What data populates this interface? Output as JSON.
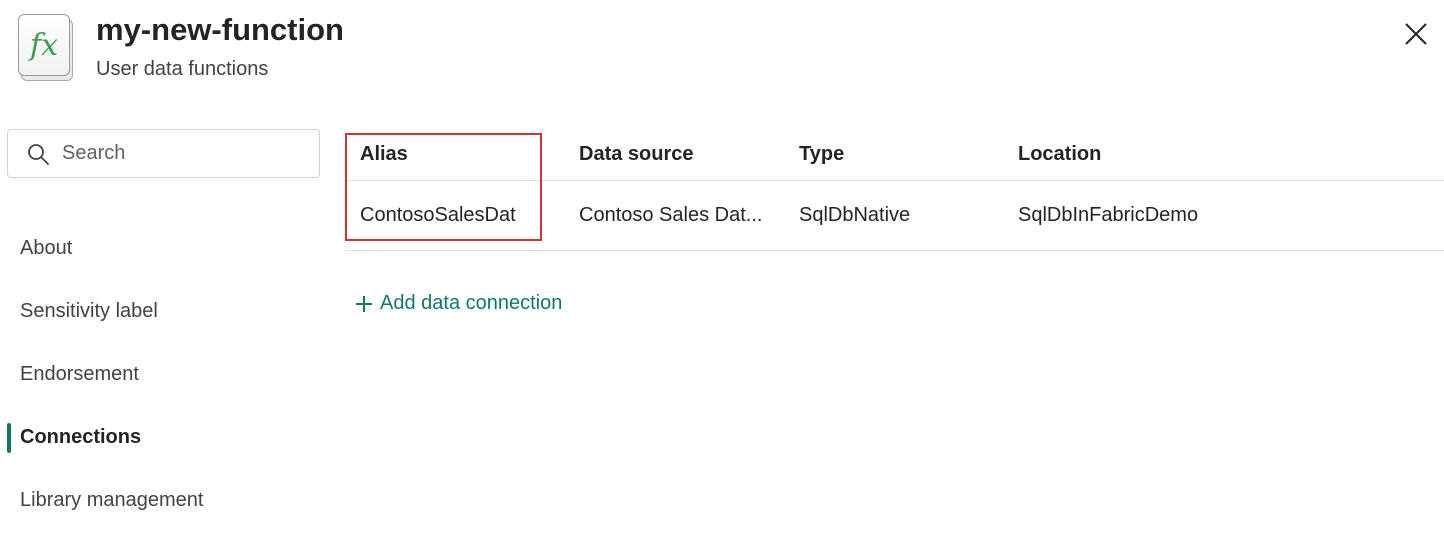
{
  "header": {
    "title": "my-new-function",
    "subtitle": "User data functions",
    "icon_glyph": "fx",
    "icon_name": "function-icon",
    "close_icon": "close-icon"
  },
  "search": {
    "placeholder": "Search",
    "value": ""
  },
  "sidebar": {
    "items": [
      {
        "label": "About",
        "active": false
      },
      {
        "label": "Sensitivity label",
        "active": false
      },
      {
        "label": "Endorsement",
        "active": false
      },
      {
        "label": "Connections",
        "active": true
      },
      {
        "label": "Library management",
        "active": false
      }
    ]
  },
  "connections": {
    "columns": [
      "Alias",
      "Data source",
      "Type",
      "Location"
    ],
    "rows": [
      [
        "ContosoSalesDat",
        "Contoso Sales Dat...",
        "SqlDbNative",
        "SqlDbInFabricDemo"
      ]
    ],
    "add_label": "Add data connection",
    "add_icon": "plus-icon"
  },
  "colors": {
    "accent": "#117865",
    "highlight": "#d13438",
    "icon_green": "#3d9a4f"
  }
}
